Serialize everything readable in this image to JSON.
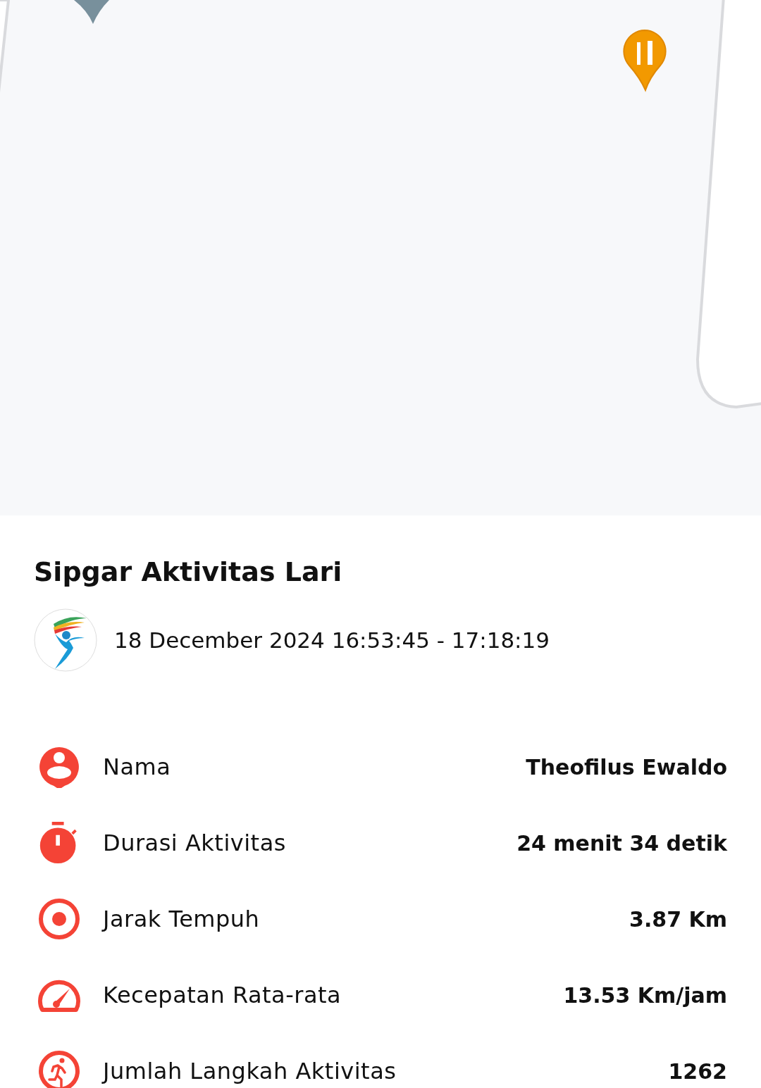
{
  "title": "Sipgar Aktivitas Lari",
  "activity": {
    "date_range": "18 December 2024 16:53:45 - 17:18:19"
  },
  "stats": [
    {
      "kind": "person",
      "label": "Nama",
      "value": "Theofilus Ewaldo"
    },
    {
      "kind": "timer",
      "label": "Durasi Aktivitas",
      "value": "24 menit 34 detik"
    },
    {
      "kind": "target",
      "label": "Jarak Tempuh",
      "value": "3.87 Km"
    },
    {
      "kind": "speed",
      "label": "Kecepatan Rata-rata",
      "value": "13.53 Km/jam"
    },
    {
      "kind": "run",
      "label": "Jumlah Langkah Aktivitas",
      "value": "1262"
    }
  ]
}
